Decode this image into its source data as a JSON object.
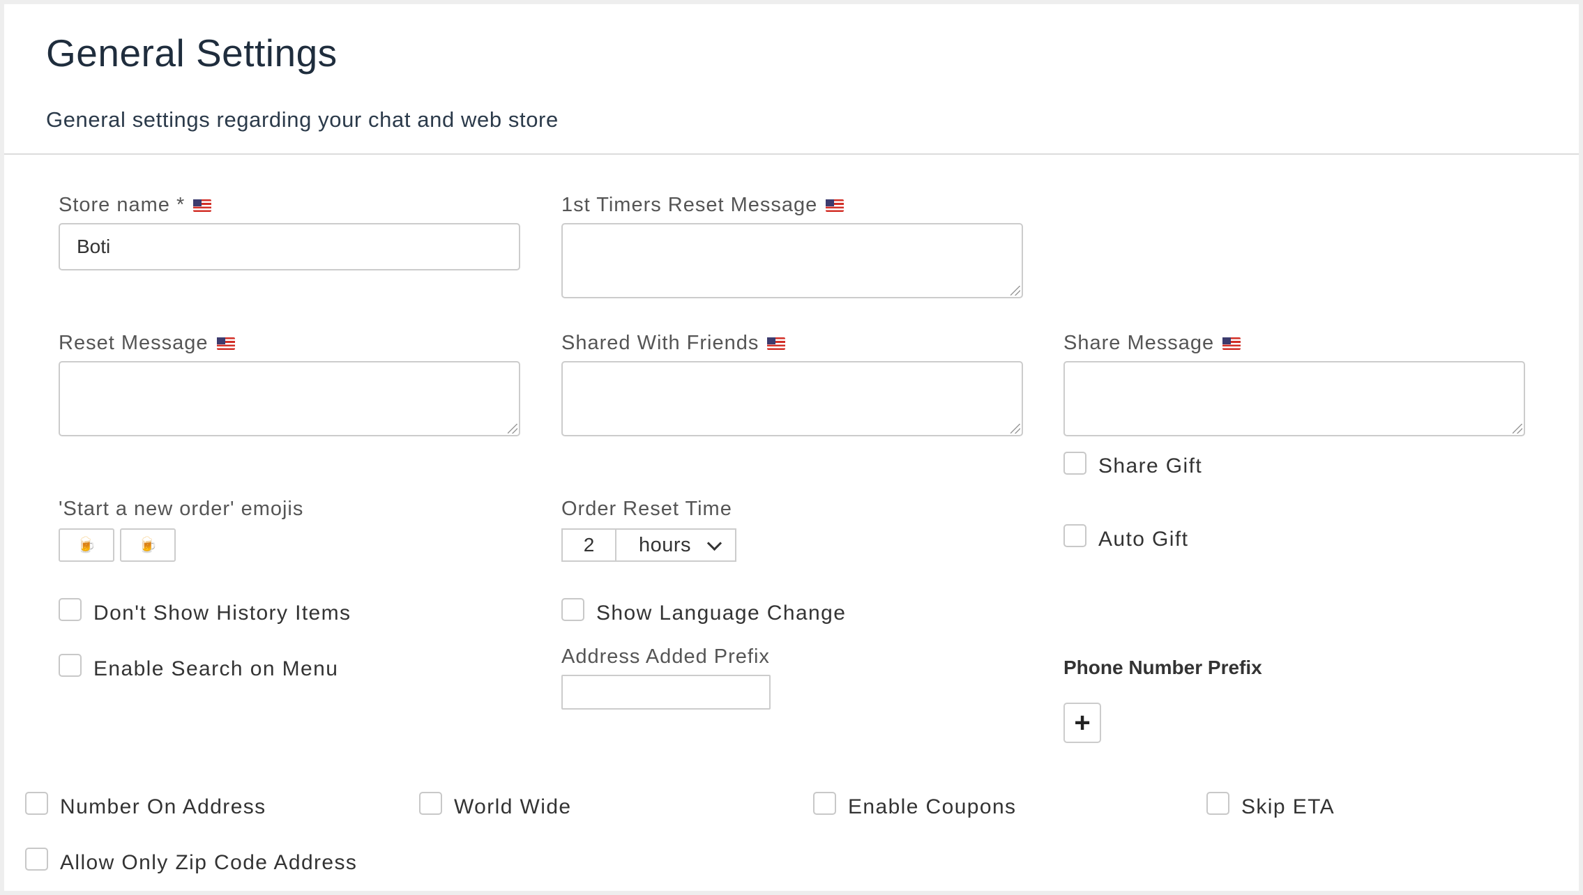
{
  "header": {
    "title": "General Settings",
    "subtitle": "General settings regarding your chat and web store"
  },
  "fields": {
    "store_name": {
      "label": "Store name *",
      "value": "Boti"
    },
    "first_timers_reset_message": {
      "label": "1st Timers Reset Message",
      "value": ""
    },
    "reset_message": {
      "label": "Reset Message",
      "value": ""
    },
    "shared_with_friends": {
      "label": "Shared With Friends",
      "value": ""
    },
    "share_message": {
      "label": "Share Message",
      "value": ""
    },
    "new_order_emojis": {
      "label": "'Start a new order' emojis",
      "emoji_1": "🍺",
      "emoji_2": "🍺"
    },
    "order_reset_time": {
      "label": "Order Reset Time",
      "value": "2",
      "unit": "hours"
    },
    "address_added_prefix": {
      "label": "Address Added Prefix",
      "value": ""
    },
    "phone_number_prefix": {
      "label": "Phone Number Prefix",
      "add_label": "+"
    }
  },
  "checkboxes": {
    "share_gift": "Share Gift",
    "auto_gift": "Auto Gift",
    "dont_show_history": "Don't Show History Items",
    "show_language_change": "Show Language Change",
    "enable_search_menu": "Enable Search on Menu",
    "number_on_address": "Number On Address",
    "world_wide": "World Wide",
    "enable_coupons": "Enable Coupons",
    "skip_eta": "Skip ETA",
    "allow_only_zip": "Allow Only Zip Code Address"
  },
  "icons": {
    "flag": "us-flag-icon",
    "chevron": "chevron-down-icon",
    "plus": "plus-icon"
  },
  "colors": {
    "title": "#1f2d3d",
    "border": "#cccccc",
    "background": "#eeeeee",
    "panel": "#ffffff"
  }
}
